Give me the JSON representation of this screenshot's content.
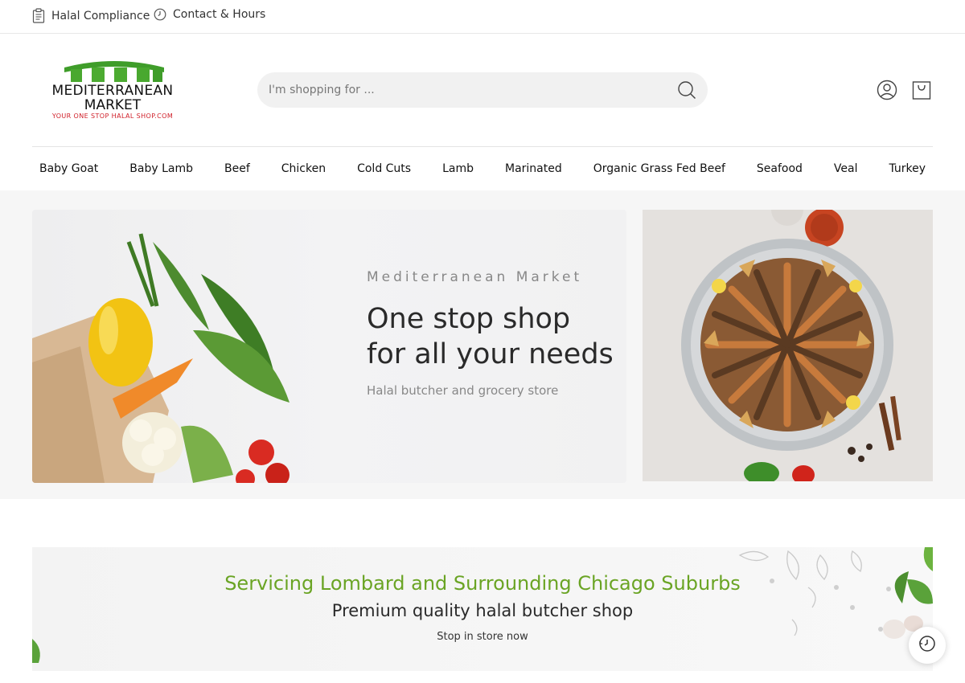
{
  "topbar": {
    "halal_compliance": "Halal Compliance",
    "contact_hours": "Contact & Hours"
  },
  "logo": {
    "line1": "MEDITERRANEAN",
    "line2": "MARKET",
    "tagline": "YOUR ONE STOP HALAL SHOP.COM"
  },
  "search": {
    "placeholder": "I'm shopping for ..."
  },
  "nav": {
    "items": [
      "Baby Goat",
      "Baby Lamb",
      "Beef",
      "Chicken",
      "Cold Cuts",
      "Lamb",
      "Marinated",
      "Organic Grass Fed Beef",
      "Seafood",
      "Veal",
      "Turkey"
    ]
  },
  "hero": {
    "eyebrow": "Mediterranean Market",
    "title_line1": "One stop shop",
    "title_line2": "for all your needs",
    "subtitle": "Halal butcher and grocery store"
  },
  "service": {
    "title": "Servicing Lombard and Surrounding Chicago Suburbs",
    "subtitle": "Premium quality halal butcher shop",
    "note": "Stop in store now"
  },
  "colors": {
    "accent_green": "#6aa424",
    "logo_red": "#d0202a"
  },
  "icons": [
    "clipboard-icon",
    "clock-icon",
    "search-icon",
    "user-icon",
    "shopping-bag-icon",
    "history-icon"
  ]
}
